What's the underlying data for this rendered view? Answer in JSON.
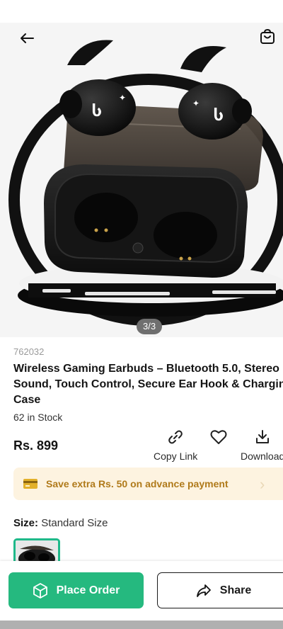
{
  "header": {
    "back_icon": "arrow-left-icon",
    "cart_icon": "shopping-bag-icon"
  },
  "gallery": {
    "counter": "3/3"
  },
  "product": {
    "sku": "762032",
    "title": "Wireless Gaming Earbuds – Bluetooth 5.0, Stereo Sound, Touch Control, Secure Ear Hook & Charging Case",
    "stock": "62 in Stock",
    "price": "Rs. 899"
  },
  "actions": {
    "copy_link_label": "Copy Link",
    "download_label": "Download",
    "copy_link_icon": "link-icon",
    "wishlist_icon": "heart-icon",
    "download_icon": "download-icon"
  },
  "promo": {
    "text": "Save extra Rs. 50 on advance payment",
    "icon": "credit-card-icon",
    "chevron": "›"
  },
  "size": {
    "label": "Size:",
    "value": "Standard Size"
  },
  "buttons": {
    "place_order": "Place Order",
    "share": "Share",
    "order_icon": "box-icon",
    "share_icon": "share-arrow-icon"
  },
  "colors": {
    "primary_green": "#25b97f",
    "promo_bg": "#fdf3e0",
    "promo_text": "#b07a1a"
  }
}
